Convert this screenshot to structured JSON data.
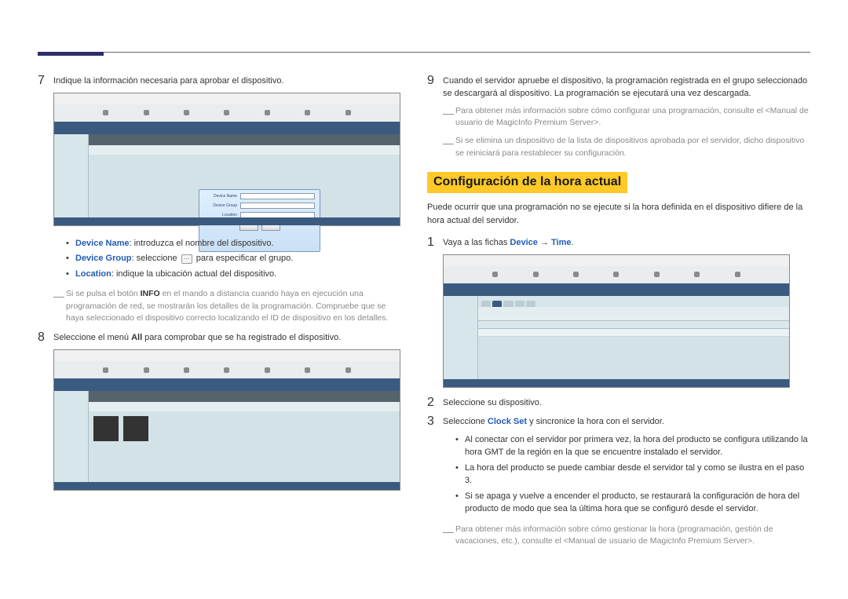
{
  "left": {
    "step7_text": "Indique la información necesaria para aprobar el dispositivo.",
    "bullets7": {
      "device_name_label": "Device Name",
      "device_name_text": ": introduzca el nombre del dispositivo.",
      "device_group_label": "Device Group",
      "device_group_text_a": ": seleccione ",
      "device_group_text_b": " para especificar el grupo.",
      "location_label": "Location",
      "location_text": ": indique la ubicación actual del dispositivo."
    },
    "note7_a": "Si se pulsa el botón ",
    "note7_info": "INFO",
    "note7_b": " en el mando a distancia cuando haya en ejecución una programación de red, se mostrarán los detalles de la programación. Compruebe que se haya seleccionado el dispositivo correcto localizando el ID de dispositivo en los detalles.",
    "step8_a": "Seleccione el menú ",
    "step8_all": "All",
    "step8_b": " para comprobar que se ha registrado el dispositivo."
  },
  "right": {
    "step9_text": "Cuando el servidor apruebe el dispositivo, la programación registrada en el grupo seleccionado se descargará al dispositivo. La programación se ejecutará una vez descargada.",
    "note9a": "Para obtener más información sobre cómo configurar una programación, consulte el <Manual de usuario de MagicInfo Premium Server>.",
    "note9b": "Si se elimina un dispositivo de la lista de dispositivos aprobada por el servidor, dicho dispositivo se reiniciará para restablecer su configuración.",
    "heading": "Configuración de la hora actual",
    "intro": "Puede ocurrir que una programación no se ejecute si la hora definida en el dispositivo difiere de la hora actual del servidor.",
    "step1_a": "Vaya a las fichas ",
    "step1_dev": "Device",
    "step1_arrow": " → ",
    "step1_time": "Time",
    "step1_dot": ".",
    "step2": "Seleccione su dispositivo.",
    "step3_a": "Seleccione ",
    "step3_clock": "Clock Set",
    "step3_b": " y sincronice la hora con el servidor.",
    "bullets3": {
      "b1": "Al conectar con el servidor por primera vez, la hora del producto se configura utilizando la hora GMT de la región en la que se encuentre instalado el servidor.",
      "b2": "La hora del producto se puede cambiar desde el servidor tal y como se ilustra en el paso 3.",
      "b3": "Si se apaga y vuelve a encender el producto, se restaurará la configuración de hora del producto de modo que sea la última hora que se configuró desde el servidor."
    },
    "note_end": "Para obtener más información sobre cómo gestionar la hora (programación, gestión de vacaciones, etc.), consulte el <Manual de usuario de MagicInfo Premium Server>."
  },
  "dialog": {
    "device_name": "Device Name",
    "device_group": "Device Group",
    "location": "Location"
  },
  "icon_glyph": "⋯"
}
